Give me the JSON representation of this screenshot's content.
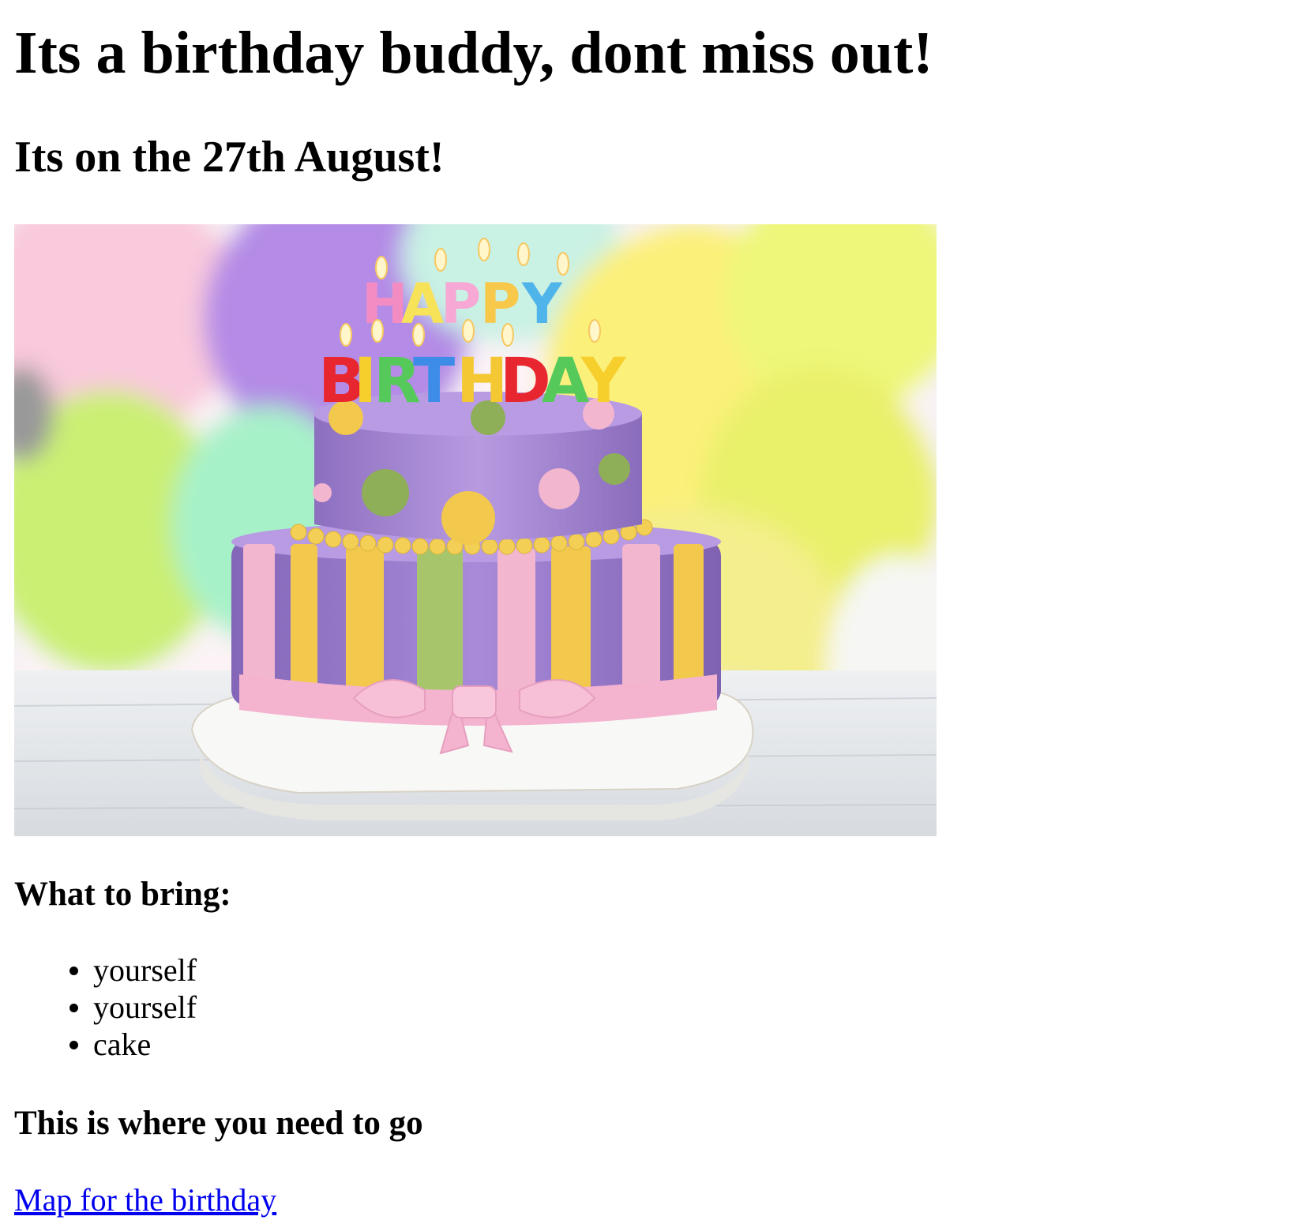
{
  "page": {
    "title": "Its a birthday buddy, dont miss out!",
    "date_line": "Its on the 27th August!",
    "image": {
      "alt": "Birthday cake",
      "candles_top": "HAPPY",
      "candles_bottom": "BIRTHDAY"
    },
    "bring_heading": "What to bring:",
    "bring_items": [
      "yourself",
      "yourself",
      "cake"
    ],
    "where_heading": "This is where you need to go",
    "map_link": "Map for the birthday"
  },
  "colors": {
    "link": "#0000ee",
    "text": "#000000",
    "cake_purple": "#a98bd6",
    "cake_pink": "#f2b6cf",
    "cake_yellow": "#f2c94c",
    "cake_green": "#a7c66b"
  },
  "icons": {
    "list_bullet": "bullet-icon"
  }
}
